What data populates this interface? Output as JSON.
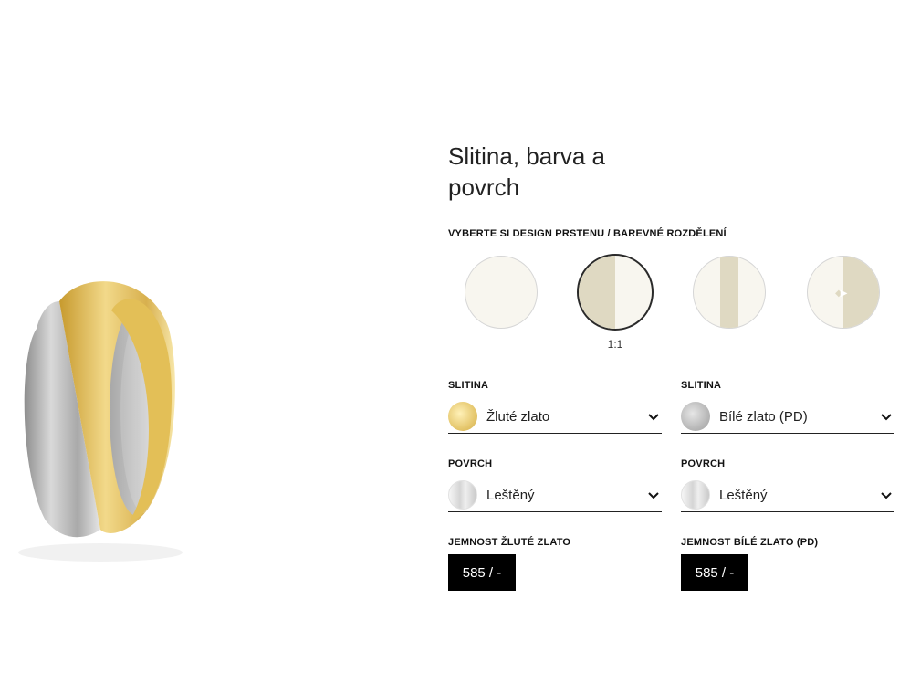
{
  "heading": "Slitina, barva a povrch",
  "design": {
    "label": "Vyberte si design prstenu / barevné rozdělení",
    "options": [
      {
        "name": "single",
        "caption": ""
      },
      {
        "name": "split-half",
        "caption": "1:1"
      },
      {
        "name": "center-stripe",
        "caption": ""
      },
      {
        "name": "adjustable-split",
        "caption": ""
      }
    ],
    "selected_index": 1
  },
  "left": {
    "alloy_label": "Slitina",
    "alloy_value": "Žluté zlato",
    "surface_label": "Povrch",
    "surface_value": "Leštěný",
    "fineness_label": "Jemnost žluté zlato",
    "fineness_value": "585 / -"
  },
  "right": {
    "alloy_label": "Slitina",
    "alloy_value": "Bílé zlato (PD)",
    "surface_label": "Povrch",
    "surface_value": "Leštěný",
    "fineness_label": "Jemnost bílé zlato (PD)",
    "fineness_value": "585 / -"
  },
  "colors": {
    "yellow_gold": "#e6c86f",
    "white_gold": "#b9b9b9",
    "design_fill": "#dfd9c2",
    "design_bg": "#f8f6ef",
    "badge_bg": "#000000"
  }
}
